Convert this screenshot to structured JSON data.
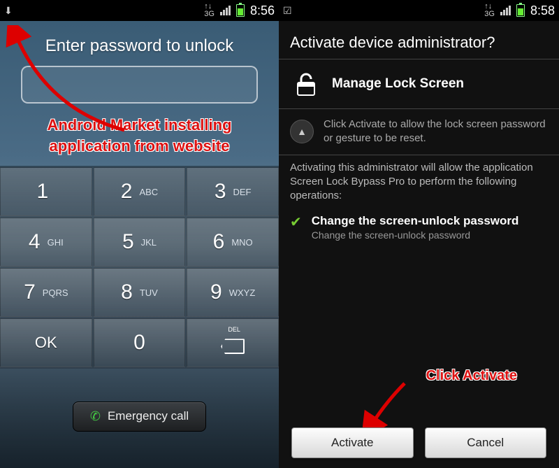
{
  "left": {
    "status": {
      "time": "8:56",
      "net": "3G"
    },
    "title": "Enter password to unlock",
    "annotation": "Android Market installing application from website",
    "keys": [
      {
        "num": "1",
        "ltr": ""
      },
      {
        "num": "2",
        "ltr": "ABC"
      },
      {
        "num": "3",
        "ltr": "DEF"
      },
      {
        "num": "4",
        "ltr": "GHI"
      },
      {
        "num": "5",
        "ltr": "JKL"
      },
      {
        "num": "6",
        "ltr": "MNO"
      },
      {
        "num": "7",
        "ltr": "PQRS"
      },
      {
        "num": "8",
        "ltr": "TUV"
      },
      {
        "num": "9",
        "ltr": "WXYZ"
      }
    ],
    "ok": "OK",
    "zero": "0",
    "del": "DEL",
    "emergency": "Emergency call"
  },
  "right": {
    "status": {
      "time": "8:58",
      "net": "3G"
    },
    "title": "Activate device administrator?",
    "app_name": "Manage Lock Screen",
    "hint": "Click Activate to allow the lock screen password or gesture to be reset.",
    "paragraph": "Activating this administrator will allow the application Screen Lock Bypass Pro to perform the following operations:",
    "perm_title": "Change the screen-unlock password",
    "perm_desc": "Change the screen-unlock password",
    "annotation": "Click Activate",
    "activate": "Activate",
    "cancel": "Cancel"
  }
}
